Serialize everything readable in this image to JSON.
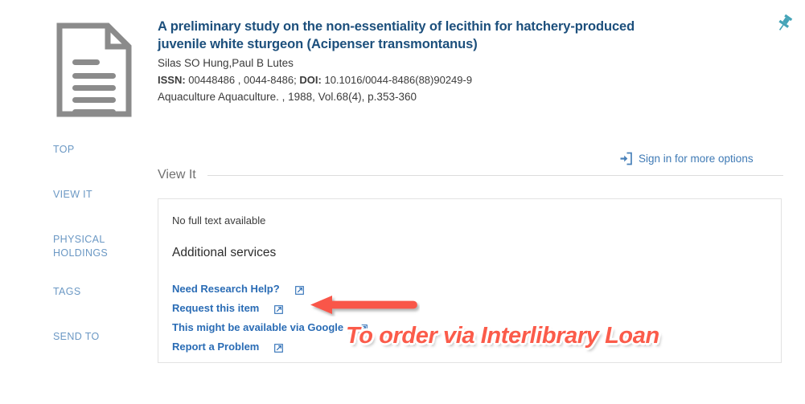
{
  "record": {
    "thumbnail_icon": "document-icon",
    "title": "A preliminary study on the non-essentiality of lecithin for hatchery-produced juvenile white sturgeon (Acipenser transmontanus)",
    "authors": "Silas SO Hung,Paul B Lutes",
    "issn_label": "ISSN:",
    "issn_value": "00448486 , 0044-8486;",
    "doi_label": "DOI:",
    "doi_value": "10.1016/0044-8486(88)90249-9",
    "source": "Aquaculture Aquaculture. , 1988, Vol.68(4), p.353-360",
    "pin_icon": "pin-icon",
    "title_color": "#1c4f7c"
  },
  "section_nav": {
    "items": [
      {
        "label": "TOP"
      },
      {
        "label": "VIEW IT"
      },
      {
        "label": "PHYSICAL HOLDINGS"
      },
      {
        "label": "TAGS"
      },
      {
        "label": "SEND TO"
      }
    ],
    "color": "#6b98c4"
  },
  "signin": {
    "icon": "sign-in-icon",
    "label": "Sign in for more options",
    "color": "#3f7ab5"
  },
  "view_it": {
    "heading": "View It",
    "no_fulltext": "No full text available",
    "additional_services_heading": "Additional services",
    "links": [
      {
        "label": "Need Research Help?",
        "icon": "external-link-icon"
      },
      {
        "label": "Request this item",
        "icon": "external-link-icon"
      },
      {
        "label": "This might be available via Google",
        "icon": "external-link-icon"
      },
      {
        "label": "Report a Problem",
        "icon": "external-link-icon"
      }
    ],
    "link_color": "#2a6cb5"
  },
  "annotation": {
    "arrow_icon": "left-arrow-annotation",
    "arrow_color": "#f9574a",
    "text": "To order via Interlibrary Loan",
    "text_color": "#fb5b4a"
  }
}
